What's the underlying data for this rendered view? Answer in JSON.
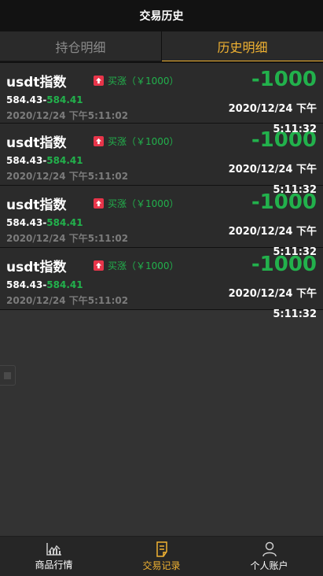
{
  "header": {
    "title": "交易历史"
  },
  "tabs": [
    {
      "label": "持仓明细",
      "active": false
    },
    {
      "label": "历史明细",
      "active": true
    }
  ],
  "records": [
    {
      "name": "usdt指数",
      "direction": "买涨（￥1000）",
      "open_price": "584.43",
      "separator": "-",
      "close_price": "584.41",
      "open_time": "2020/12/24 下午5:11:02",
      "profit": "-1000",
      "close_time": "2020/12/24 下午5:11:32"
    },
    {
      "name": "usdt指数",
      "direction": "买涨（￥1000）",
      "open_price": "584.43",
      "separator": "-",
      "close_price": "584.41",
      "open_time": "2020/12/24 下午5:11:02",
      "profit": "-1000",
      "close_time": "2020/12/24 下午5:11:32"
    },
    {
      "name": "usdt指数",
      "direction": "买涨（￥1000）",
      "open_price": "584.43",
      "separator": "-",
      "close_price": "584.41",
      "open_time": "2020/12/24 下午5:11:02",
      "profit": "-1000",
      "close_time": "2020/12/24 下午5:11:32"
    },
    {
      "name": "usdt指数",
      "direction": "买涨（￥1000）",
      "open_price": "584.43",
      "separator": "-",
      "close_price": "584.41",
      "open_time": "2020/12/24 下午5:11:02",
      "profit": "-1000",
      "close_time": "2020/12/24 下午5:11:32"
    }
  ],
  "bottom_nav": [
    {
      "label": "商品行情",
      "icon": "chart-icon",
      "active": false
    },
    {
      "label": "交易记录",
      "icon": "document-icon",
      "active": true
    },
    {
      "label": "个人账户",
      "icon": "user-icon",
      "active": false
    }
  ],
  "colors": {
    "accent": "#f0b232",
    "profit": "#22b14c",
    "rise_badge": "#e8354a",
    "background": "#333333",
    "topbar": "#121212"
  }
}
